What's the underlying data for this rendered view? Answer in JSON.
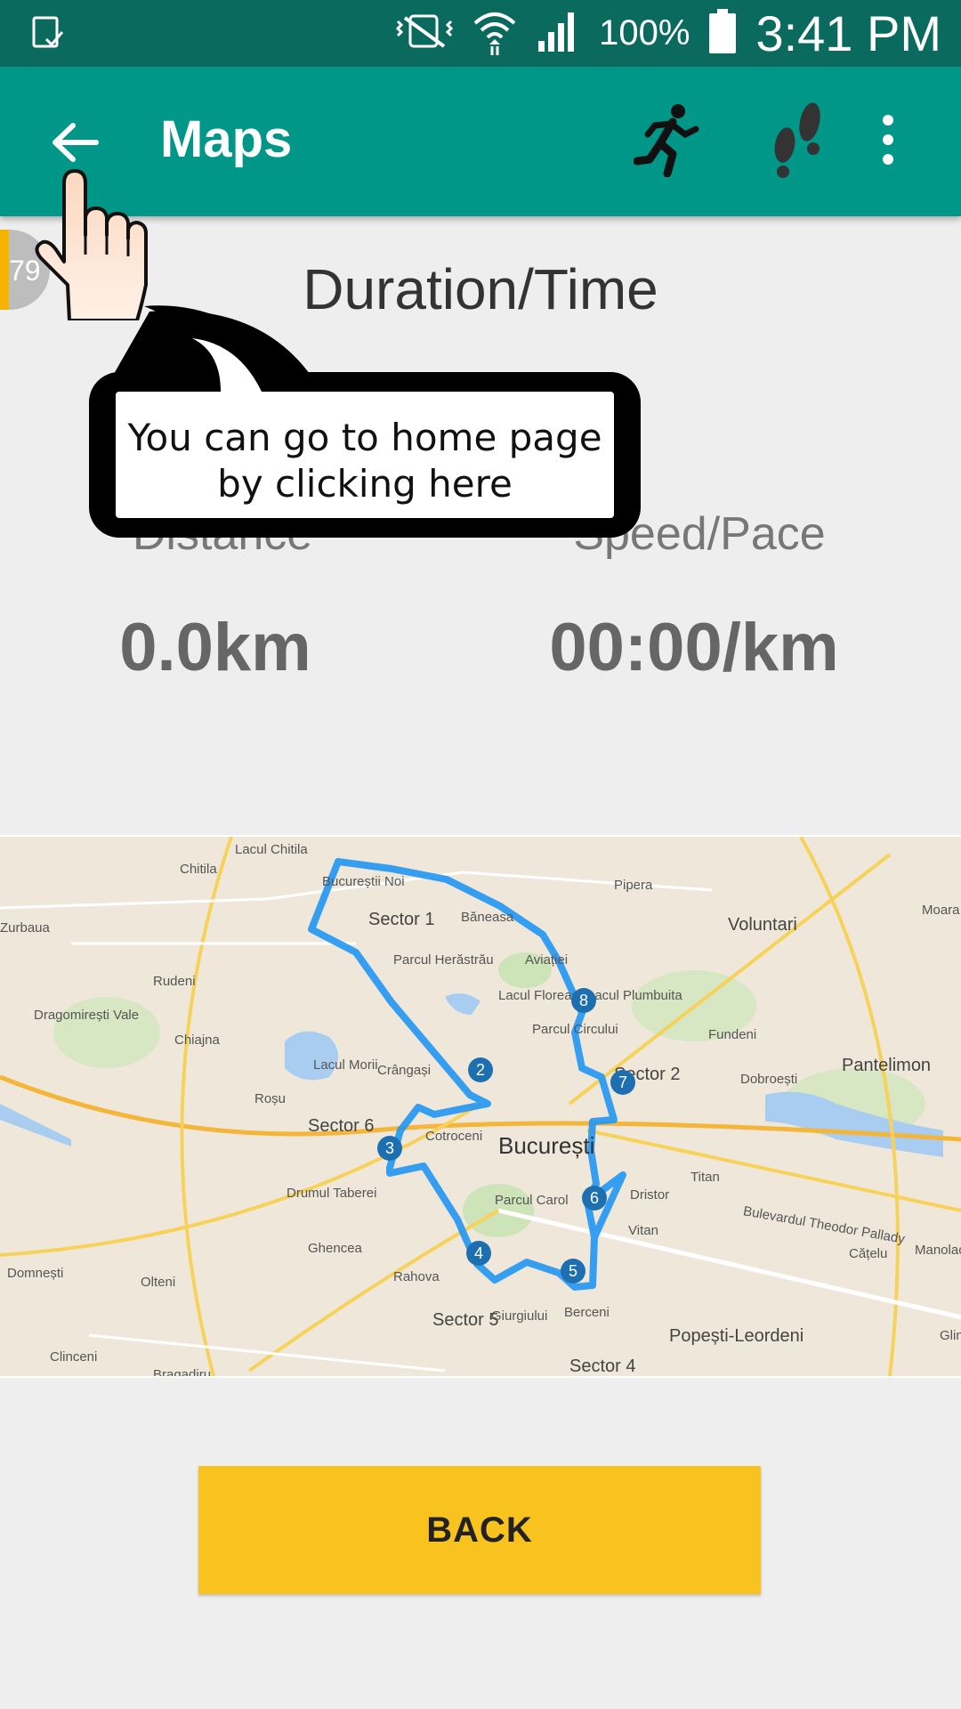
{
  "status_bar": {
    "battery": "100%",
    "time": "3:41 PM",
    "icons": [
      "screenshot-icon",
      "mute-icon",
      "wifi-icon",
      "signal-icon",
      "battery-icon"
    ]
  },
  "app_bar": {
    "title": "Maps",
    "icons": [
      "back-arrow-icon",
      "runner-icon",
      "footsteps-icon",
      "more-vert-icon"
    ],
    "color": "#009688"
  },
  "side_badge": {
    "value": "79"
  },
  "workout": {
    "duration_label": "Duration/Time",
    "distance_label": "Distance",
    "distance_value": "0.0km",
    "pace_label": "Speed/Pace",
    "pace_value": "00:00/km"
  },
  "map": {
    "city": "București",
    "labels": {
      "lacul_chitila": "Lacul Chitila",
      "chitila": "Chitila",
      "bucurestii_noi": "Bucureștii Noi",
      "sector1": "Sector 1",
      "banesa": "Băneasa",
      "pipera": "Pipera",
      "voluntari": "Voluntari",
      "moara": "Moara D",
      "zurbaua": "Zurbaua",
      "rudeni": "Rudeni",
      "parcul_herastrau": "Parcul Herăstrău",
      "aviatiei": "Aviației",
      "lacul_floreasca": "Lacul Floreasca",
      "lacul_plumbuita": "Lacul Plumbuita",
      "dragomiresti": "Dragomirești Vale",
      "chiajna": "Chiajna",
      "parcul_circului": "Parcul Circului",
      "fundeni": "Fundeni",
      "pantelimon": "Pantelimon",
      "lacul_morii": "Lacul Morii",
      "crangasi": "Crângași",
      "sector2": "Sector 2",
      "dobroesti": "Dobroești",
      "rosu": "Roșu",
      "sector6": "Sector 6",
      "cotroceni": "Cotroceni",
      "drumul_taberei": "Drumul Taberei",
      "parcul_carol": "Parcul Carol",
      "dristor": "Dristor",
      "titan": "Titan",
      "vitan": "Vitan",
      "ghencea": "Ghencea",
      "rahova": "Rahova",
      "domnesti": "Domnești",
      "olteni": "Olteni",
      "sector5": "Sector 5",
      "giurgiului": "Giurgiului",
      "berceni": "Berceni",
      "popesti": "Popești-Leordeni",
      "catelu": "Cățelu",
      "manolache": "Manolach",
      "sector4": "Sector 4",
      "clinceni": "Clinceni",
      "glina": "Glin",
      "bragadiru": "Bragadiru",
      "blvd": "Bulevardul Theodor Pallady"
    },
    "markers": [
      "2",
      "3",
      "4",
      "5",
      "6",
      "7",
      "8"
    ],
    "route_color": "#2196f3"
  },
  "back_button": {
    "label": "BACK"
  },
  "tutorial": {
    "text_line1": "You can go to home page",
    "text_line2": "by clicking here"
  }
}
